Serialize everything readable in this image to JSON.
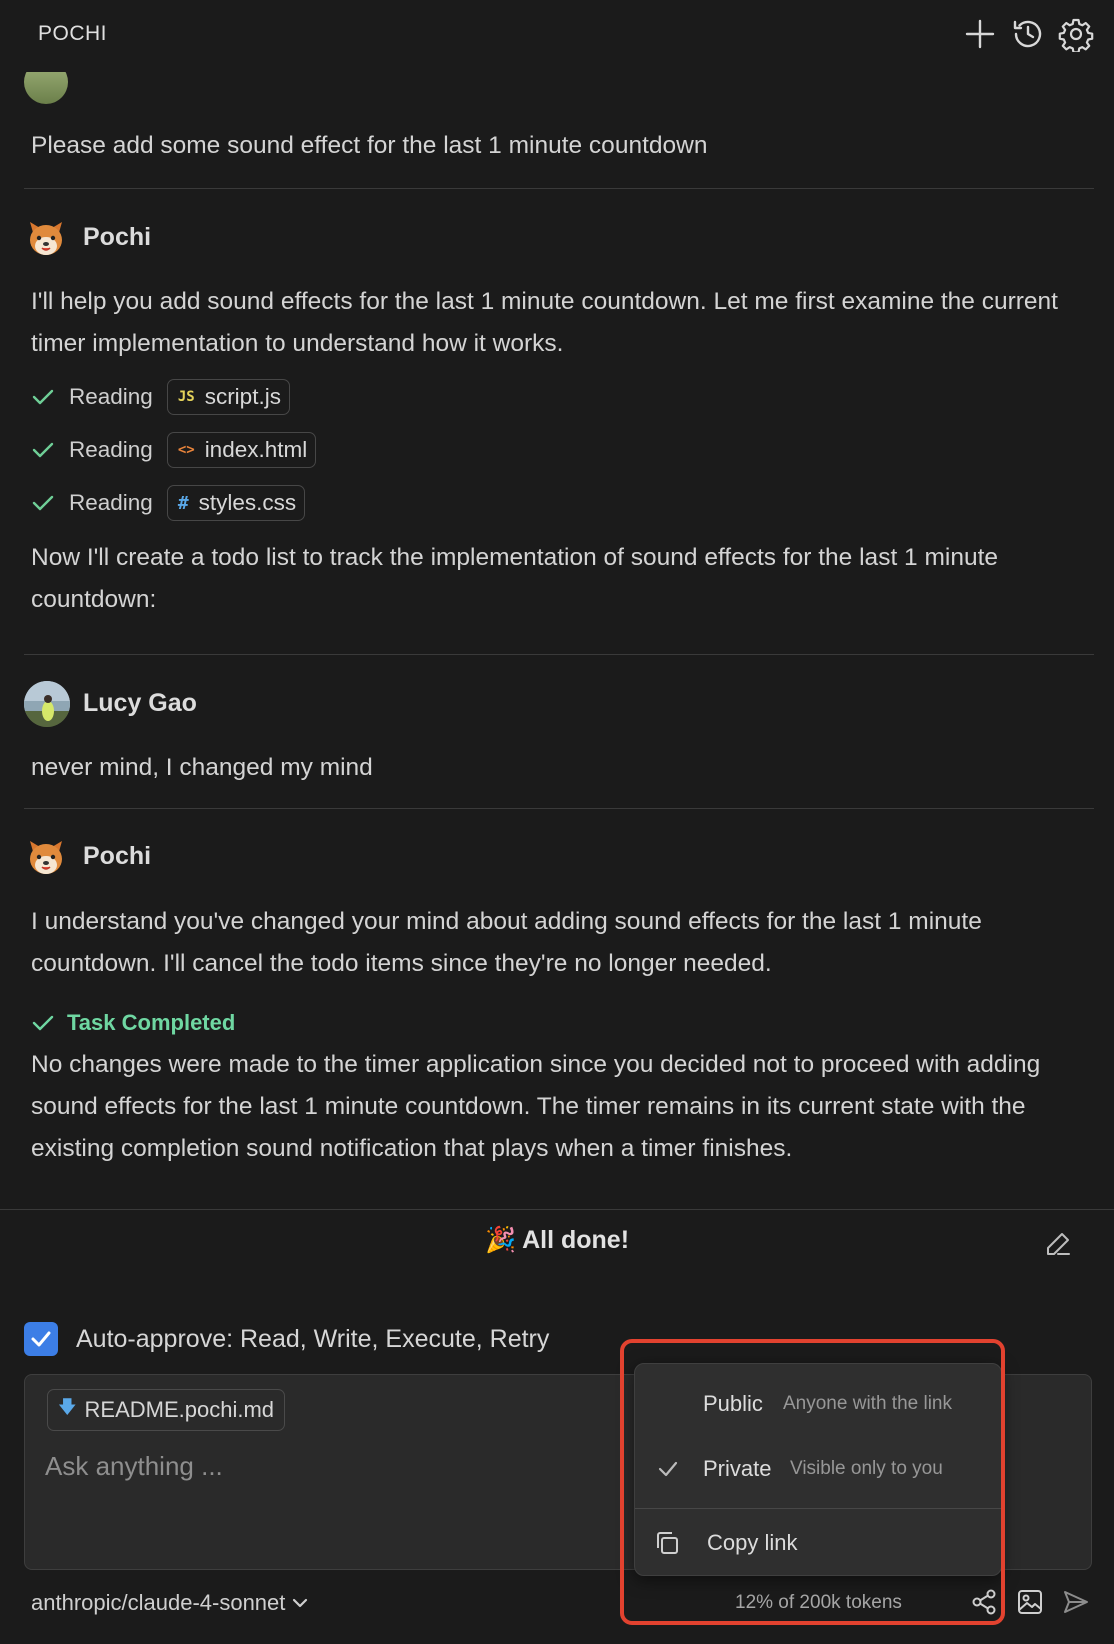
{
  "app": {
    "title": "POCHI"
  },
  "header": {
    "new_icon": "plus-icon",
    "history_icon": "history-icon",
    "settings_icon": "gear-icon"
  },
  "messages": {
    "user1": {
      "text": "Please add some sound effect for the last 1 minute countdown"
    },
    "pochi1": {
      "author": "Pochi",
      "text1": "I'll help you add sound effects for the last 1 minute countdown. Let me first examine the current timer implementation to understand how it works.",
      "tools": [
        {
          "action": "Reading",
          "file_icon": "JS",
          "file": "script.js",
          "icon_color": "#e5d35b"
        },
        {
          "action": "Reading",
          "file_icon": "<>",
          "file": "index.html",
          "icon_color": "#e8843b"
        },
        {
          "action": "Reading",
          "file_icon": "#",
          "file": "styles.css",
          "icon_color": "#5aa8e8"
        }
      ],
      "text2": "Now I'll create a todo list to track the implementation of sound effects for the last 1 minute countdown:"
    },
    "user2": {
      "author": "Lucy Gao",
      "text": "never mind, I changed my mind"
    },
    "pochi2": {
      "author": "Pochi",
      "text1": "I understand you've changed your mind about adding sound effects for the last 1 minute countdown. I'll cancel the todo items since they're no longer needed.",
      "completed_label": "Task Completed",
      "text2": "No changes were made to the timer application since you decided not to proceed with adding sound effects for the last 1 minute countdown. The timer remains in its current state with the existing completion sound notification that plays when a timer finishes."
    }
  },
  "status": {
    "done_text": "🎉 All done!"
  },
  "auto_approve": {
    "label": "Auto-approve: Read, Write, Execute, Retry",
    "checked": true
  },
  "composer": {
    "attachment": "README.pochi.md",
    "placeholder": "Ask anything ..."
  },
  "footer": {
    "model": "anthropic/claude-4-sonnet",
    "tokens": "12% of 200k tokens"
  },
  "share_menu": {
    "public_label": "Public",
    "public_desc": "Anyone with the link",
    "private_label": "Private",
    "private_desc": "Visible only to you",
    "selected": "Private",
    "copy_label": "Copy link"
  },
  "colors": {
    "accent": "#3c7ee6",
    "success": "#6fd7a2",
    "highlight": "#e2422f"
  }
}
